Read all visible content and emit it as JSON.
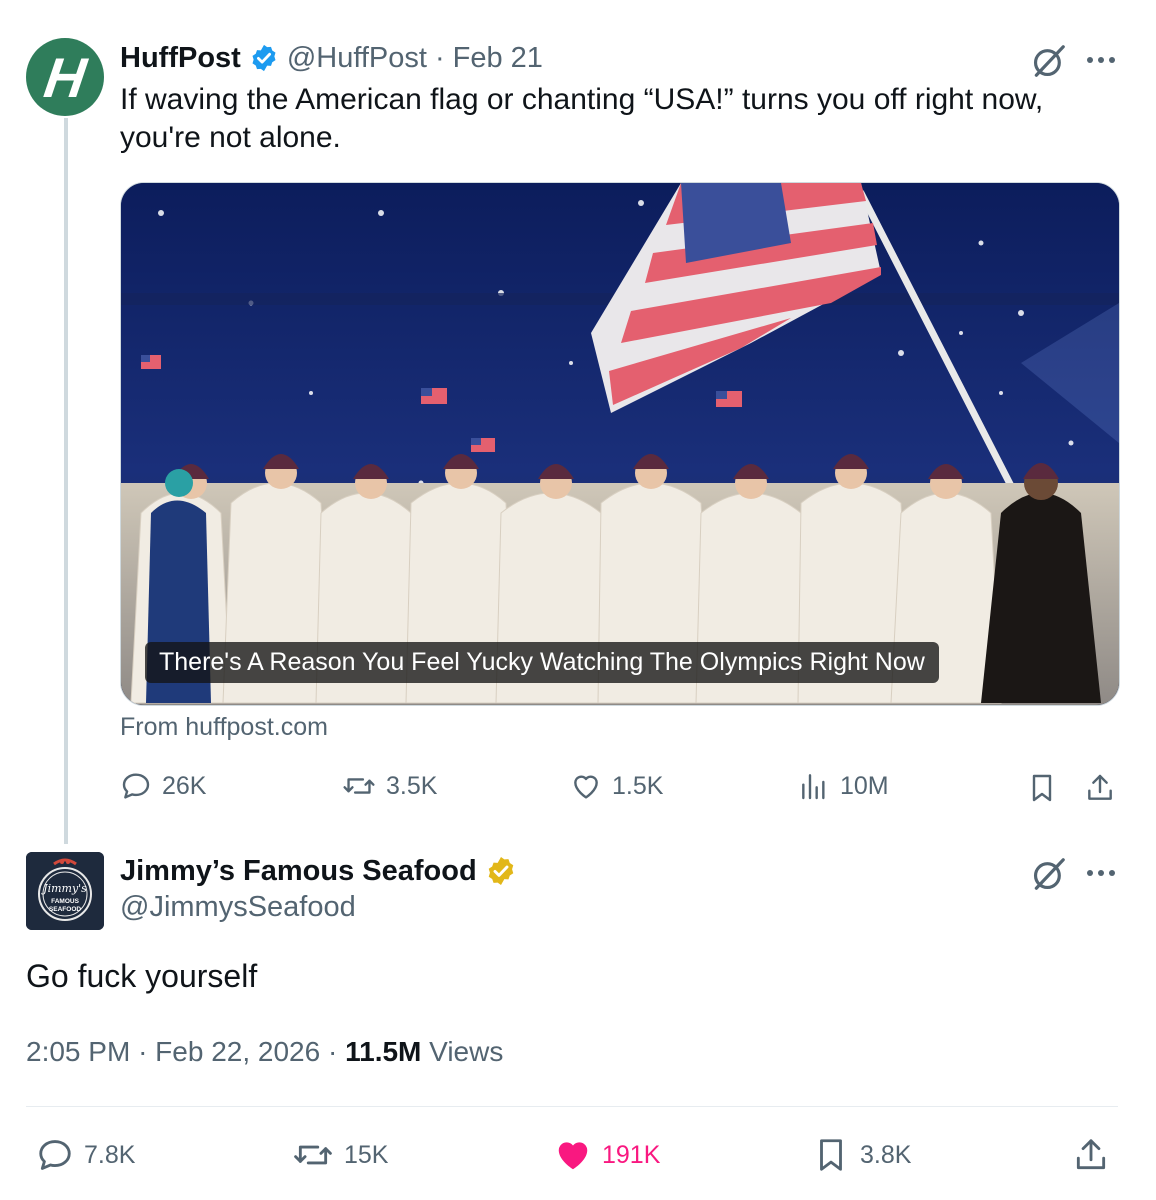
{
  "original_tweet": {
    "author_name": "HuffPost",
    "handle": "@HuffPost",
    "separator": "·",
    "date": "Feb 21",
    "text": "If waving the American flag or chanting “USA!” turns you off right now, you're not alone.",
    "avatar_letter": "H",
    "card": {
      "caption": "There's A Reason You Feel Yucky Watching The Olympics Right Now",
      "source": "From huffpost.com"
    },
    "metrics": {
      "replies": "26K",
      "reposts": "3.5K",
      "likes": "1.5K",
      "views": "10M"
    }
  },
  "reply_tweet": {
    "author_name": "Jimmy’s Famous Seafood",
    "handle": "@JimmysSeafood",
    "avatar_logo_text": "Jimmy's FAMOUS SEAFOOD",
    "text": "Go fuck yourself",
    "time": "2:05 PM",
    "date": "Feb 22, 2026",
    "separator": "·",
    "views_count": "11.5M",
    "views_label": "Views",
    "metrics": {
      "replies": "7.8K",
      "reposts": "15K",
      "likes": "191K",
      "bookmarks": "3.8K"
    }
  },
  "colors": {
    "verified_blue": "#1d9bf0",
    "verified_gold": "#e2b719",
    "like_pink": "#f91880",
    "muted_text": "#536471",
    "huffpost_green": "#2f7d5b"
  },
  "icons": [
    "verified-badge-icon",
    "grok-icon",
    "more-icon",
    "reply-icon",
    "repost-icon",
    "like-icon",
    "views-icon",
    "bookmark-icon",
    "share-icon"
  ]
}
